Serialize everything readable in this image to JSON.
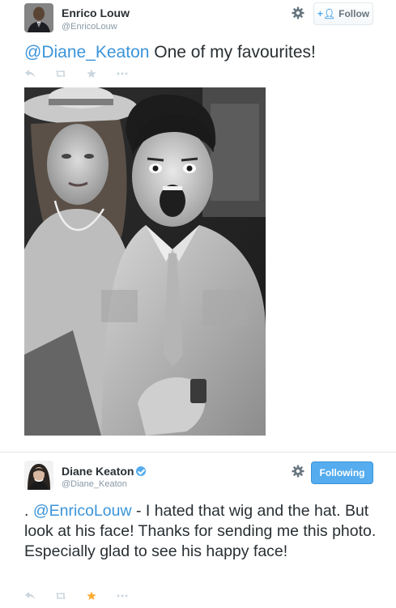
{
  "tweet1": {
    "name": "Enrico Louw",
    "handle": "@EnricoLouw",
    "follow_label": "Follow",
    "mention": "@Diane_Keaton",
    "text": " One of my favourites!",
    "photo_icon": "photo",
    "actions": [
      "reply-icon",
      "retweet-icon",
      "favorite-icon",
      "more-icon"
    ]
  },
  "tweet2": {
    "name": "Diane Keaton",
    "handle": "@Diane_Keaton",
    "following_label": "Following",
    "prefix": ". ",
    "mention": "@EnricoLouw",
    "text": " - I hated that wig and the hat. But look at his face! Thanks for sending me this photo. Especially glad to see his happy face!",
    "actions": [
      "reply-icon",
      "retweet-icon",
      "favorite-icon",
      "more-icon"
    ],
    "favorited": true
  },
  "colors": {
    "link": "#3b94d9",
    "action_gray": "#ccd6dd",
    "favorite": "#ffac33",
    "following_bg": "#55acee"
  }
}
